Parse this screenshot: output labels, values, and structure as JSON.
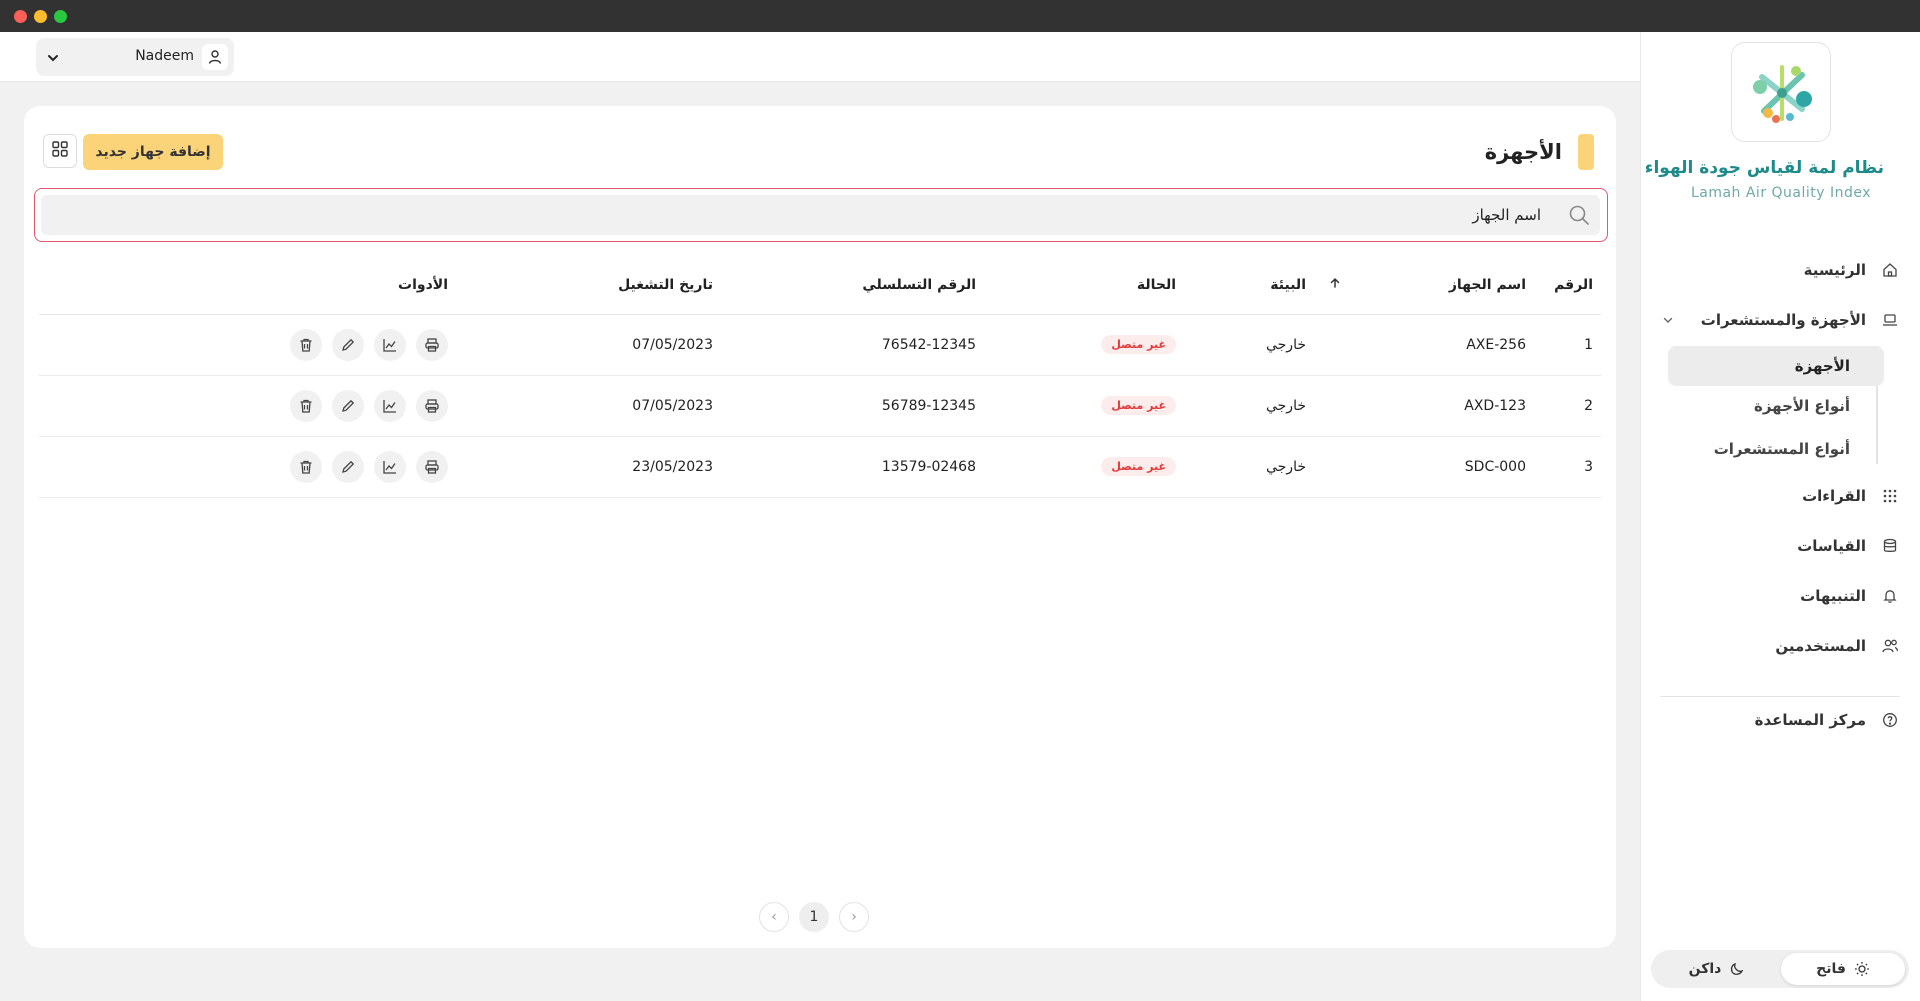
{
  "header": {
    "user_name": "Nadeem"
  },
  "brand": {
    "title": "نظام لمة لقياس جودة الهواء",
    "subtitle": "Lamah Air Quality Index"
  },
  "sidebar": {
    "home": "الرئيسية",
    "devices_group": "الأجهزة والمستشعرات",
    "sub_devices": "الأجهزة",
    "sub_device_types": "أنواع الأجهزة",
    "sub_sensor_types": "أنواع المستشعرات",
    "readings": "القراءات",
    "measurements": "القياسات",
    "alerts": "التنبيهات",
    "users": "المستخدمين",
    "help": "مركز المساعدة"
  },
  "theme": {
    "light": "فاتح",
    "dark": "داكن"
  },
  "main": {
    "title": "الأجهزة",
    "add_button": "إضافة جهاز جديد",
    "search_value": "اسم الجهاز",
    "columns": {
      "number": "الرقم",
      "device_name": "اسم الجهاز",
      "environment": "البيئة",
      "status": "الحالة",
      "serial": "الرقم التسلسلي",
      "start_date": "تاريخ التشغيل",
      "tools": "الأدوات"
    },
    "rows": [
      {
        "number": "1",
        "device_name": "AXE-256",
        "environment": "خارجي",
        "status": "غير متصل",
        "serial": "76542-12345",
        "start_date": "07/05/2023"
      },
      {
        "number": "2",
        "device_name": "AXD-123",
        "environment": "خارجي",
        "status": "غير متصل",
        "serial": "56789-12345",
        "start_date": "07/05/2023"
      },
      {
        "number": "3",
        "device_name": "SDC-000",
        "environment": "خارجي",
        "status": "غير متصل",
        "serial": "13579-02468",
        "start_date": "23/05/2023"
      }
    ],
    "pagination": {
      "current_page": "1",
      "prev": "‹",
      "next": "›"
    }
  },
  "colors": {
    "accent": "#fbd47a",
    "brand_teal": "#1f8a8a",
    "search_border": "#e5566f",
    "status_red": "#e23a3a"
  }
}
